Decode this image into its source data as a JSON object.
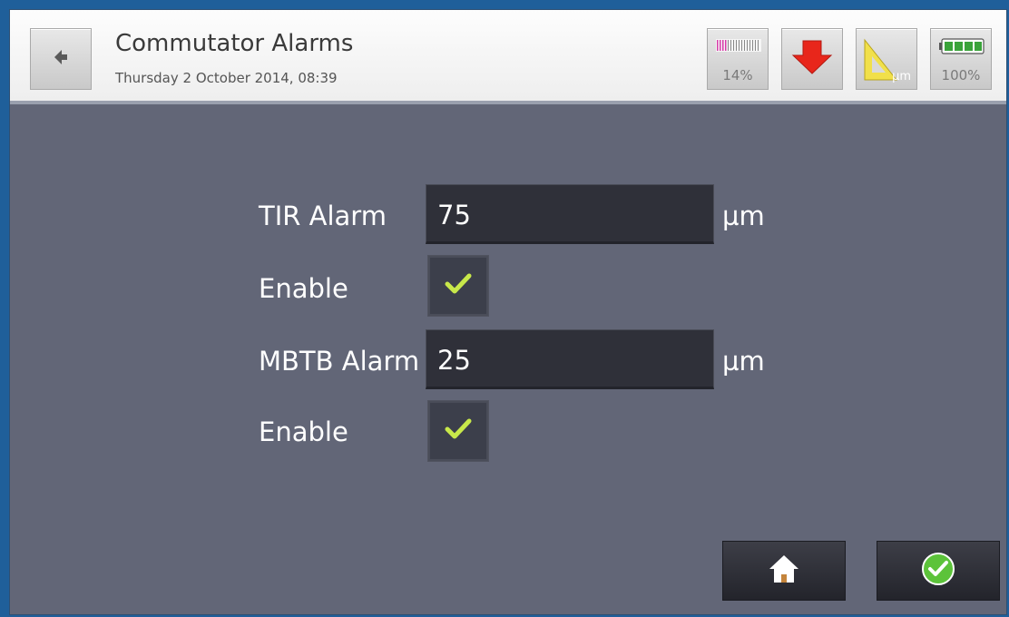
{
  "header": {
    "title": "Commutator Alarms",
    "datetime": "Thursday 2 October 2014, 08:39",
    "status": {
      "signal_label": "14%",
      "direction_icon": "arrow-down-icon",
      "units_label": "µm",
      "battery_label": "100%"
    }
  },
  "form": {
    "tir": {
      "label": "TIR Alarm",
      "value": "75",
      "unit": "µm"
    },
    "tir_enable": {
      "label": "Enable",
      "checked": true
    },
    "mbtb": {
      "label": "MBTB Alarm",
      "value": "25",
      "unit": "µm"
    },
    "mbtb_enable": {
      "label": "Enable",
      "checked": true
    }
  },
  "footer": {
    "home_icon": "home-icon",
    "confirm_icon": "confirm-check-icon"
  },
  "colors": {
    "background": "#626677",
    "field": "#2f3039",
    "check": "#c8e84a",
    "arrow": "#e8261b",
    "confirm": "#5cc33a"
  }
}
